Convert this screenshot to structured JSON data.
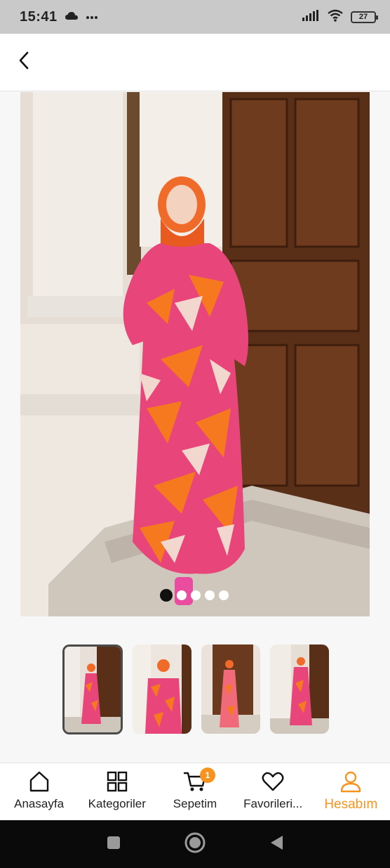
{
  "status_bar": {
    "time": "15:41",
    "battery": "27",
    "icons": [
      "cloud-icon",
      "more-dots-icon",
      "signal-icon",
      "wifi-icon",
      "battery-icon"
    ]
  },
  "header": {
    "back_icon": "chevron-left-icon"
  },
  "product_gallery": {
    "image_count": 5,
    "active_index": 0,
    "main_image": "model-photo",
    "thumbnails": [
      "thumb-1",
      "thumb-2",
      "thumb-3",
      "thumb-4"
    ],
    "selected_thumbnail": 0
  },
  "bottom_nav": {
    "items": [
      {
        "label": "Anasayfa",
        "icon": "home-icon"
      },
      {
        "label": "Kategoriler",
        "icon": "grid-icon"
      },
      {
        "label": "Sepetim",
        "icon": "cart-icon",
        "badge": "1"
      },
      {
        "label": "Favorileri...",
        "icon": "heart-icon"
      },
      {
        "label": "Hesabım",
        "icon": "user-icon",
        "active": true
      }
    ]
  },
  "colors": {
    "accent": "#f7931e",
    "status_bar": "#c9c9c9",
    "system_nav": "#0a0a0a"
  }
}
